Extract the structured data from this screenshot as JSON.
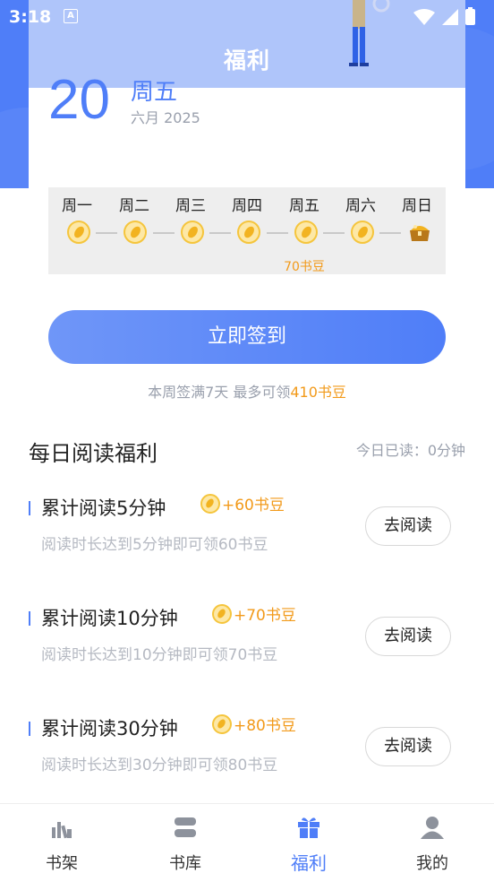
{
  "status": {
    "time": "3:18",
    "a_icon": "A"
  },
  "header": {
    "title": "福利"
  },
  "date": {
    "day": "20",
    "weekday": "周五",
    "month_year": "六月 2025"
  },
  "week": {
    "days": [
      "周一",
      "周二",
      "周三",
      "周四",
      "周五",
      "周六",
      "周日"
    ],
    "reward_label": "70书豆"
  },
  "sign": {
    "button": "立即签到",
    "hint_prefix": "本周签满7天 最多可领",
    "hint_amount": "410书豆"
  },
  "reading": {
    "title": "每日阅读福利",
    "today": "今日已读：0分钟",
    "tasks": [
      {
        "title": "累计阅读5分钟",
        "reward": "+60书豆",
        "desc": "阅读时长达到5分钟即可领60书豆",
        "button": "去阅读"
      },
      {
        "title": "累计阅读10分钟",
        "reward": "+70书豆",
        "desc": "阅读时长达到10分钟即可领70书豆",
        "button": "去阅读"
      },
      {
        "title": "累计阅读30分钟",
        "reward": "+80书豆",
        "desc": "阅读时长达到30分钟即可领80书豆",
        "button": "去阅读"
      }
    ]
  },
  "tabs": [
    {
      "label": "书架",
      "icon": "bookshelf-icon"
    },
    {
      "label": "书库",
      "icon": "library-icon"
    },
    {
      "label": "福利",
      "icon": "gift-icon",
      "active": true
    },
    {
      "label": "我的",
      "icon": "profile-icon"
    }
  ],
  "colors": {
    "accent": "#4f7ef8",
    "reward": "#f29a1a",
    "muted": "#9aa0ad"
  }
}
